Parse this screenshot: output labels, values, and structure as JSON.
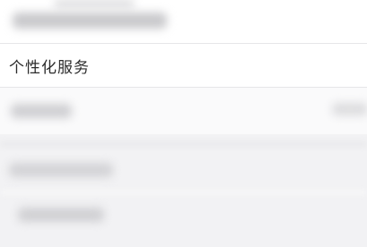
{
  "settings": {
    "highlighted_item": {
      "label": "个性化服务"
    }
  }
}
